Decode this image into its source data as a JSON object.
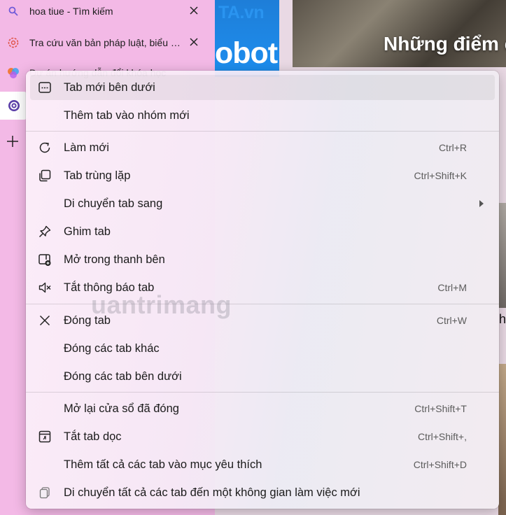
{
  "tabs": [
    {
      "title": "hoa tiue - Tìm kiếm",
      "icon": "search-icon"
    },
    {
      "title": "Tra cứu văn bản pháp luật, biểu mẫu",
      "icon": "gear-icon"
    },
    {
      "title": "Dự án hướng dẫn đổi khóa học",
      "icon": "colorful-logo-icon"
    }
  ],
  "webpage": {
    "brand_line1_a": "",
    "brand_line1_b": "TA.vn",
    "brand_line2": "obot",
    "photo_caption": "Những điểm c",
    "right_heading": "h"
  },
  "watermark": "uantrimang",
  "menu": {
    "items": [
      {
        "label": "Tab mới bên dưới",
        "shortcut": "",
        "icon": "new-tab-below-icon"
      },
      {
        "label": "Thêm tab vào nhóm mới",
        "shortcut": "",
        "icon": ""
      },
      {
        "label": "Làm mới",
        "shortcut": "Ctrl+R",
        "icon": "refresh-icon"
      },
      {
        "label": "Tab trùng lặp",
        "shortcut": "Ctrl+Shift+K",
        "icon": "duplicate-icon"
      },
      {
        "label": "Di chuyển tab sang",
        "shortcut": "",
        "icon": ""
      },
      {
        "label": "Ghim tab",
        "shortcut": "",
        "icon": "pin-icon"
      },
      {
        "label": "Mở trong thanh bên",
        "shortcut": "",
        "icon": "sidebar-icon"
      },
      {
        "label": "Tắt thông báo tab",
        "shortcut": "Ctrl+M",
        "icon": "mute-icon"
      },
      {
        "label": "Đóng tab",
        "shortcut": "Ctrl+W",
        "icon": "close-icon"
      },
      {
        "label": "Đóng các tab khác",
        "shortcut": "",
        "icon": ""
      },
      {
        "label": "Đóng các tab bên dưới",
        "shortcut": "",
        "icon": ""
      },
      {
        "label": "Mở lại cửa sổ đã đóng",
        "shortcut": "Ctrl+Shift+T",
        "icon": ""
      },
      {
        "label": "Tắt tab dọc",
        "shortcut": "Ctrl+Shift+,",
        "icon": "vertical-tabs-icon"
      },
      {
        "label": "Thêm tất cả các tab vào mục yêu thích",
        "shortcut": "Ctrl+Shift+D",
        "icon": ""
      },
      {
        "label": "Di chuyển tất cả các tab đến một không gian làm việc mới",
        "shortcut": "",
        "icon": "workspace-icon"
      }
    ]
  },
  "colors": {
    "tabstrip_bg": "#f3b9e6",
    "menu_text": "#1b1b1b",
    "shortcut_text": "#5b5b5b"
  }
}
